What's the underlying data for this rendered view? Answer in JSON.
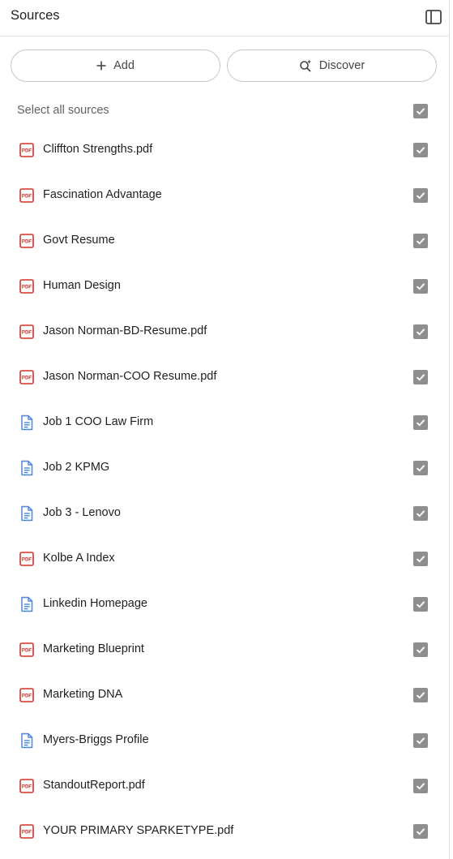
{
  "header": {
    "title": "Sources",
    "toggle_icon": "sidebar-panel-icon"
  },
  "actions": {
    "add_label": "Add",
    "add_icon": "plus-icon",
    "discover_label": "Discover",
    "discover_icon": "search-sparkle-icon"
  },
  "select_all": {
    "label": "Select all sources",
    "checked": true
  },
  "colors": {
    "pdf": "#d93025",
    "doc": "#4a86e8",
    "checkbox": "#8e8e8e"
  },
  "sources": [
    {
      "label": "Cliffton Strengths.pdf",
      "type": "pdf",
      "checked": true
    },
    {
      "label": "Fascination Advantage",
      "type": "pdf",
      "checked": true
    },
    {
      "label": "Govt Resume",
      "type": "pdf",
      "checked": true
    },
    {
      "label": "Human Design",
      "type": "pdf",
      "checked": true
    },
    {
      "label": "Jason Norman-BD-Resume.pdf",
      "type": "pdf",
      "checked": true
    },
    {
      "label": "Jason Norman-COO Resume.pdf",
      "type": "pdf",
      "checked": true
    },
    {
      "label": "Job 1 COO Law Firm",
      "type": "doc",
      "checked": true
    },
    {
      "label": "Job 2 KPMG",
      "type": "doc",
      "checked": true
    },
    {
      "label": "Job 3 - Lenovo",
      "type": "doc",
      "checked": true
    },
    {
      "label": "Kolbe A Index",
      "type": "pdf",
      "checked": true
    },
    {
      "label": "Linkedin Homepage",
      "type": "doc",
      "checked": true
    },
    {
      "label": "Marketing Blueprint",
      "type": "pdf",
      "checked": true
    },
    {
      "label": "Marketing DNA",
      "type": "pdf",
      "checked": true
    },
    {
      "label": "Myers-Briggs Profile",
      "type": "doc",
      "checked": true
    },
    {
      "label": "StandoutReport.pdf",
      "type": "pdf",
      "checked": true
    },
    {
      "label": "YOUR PRIMARY SPARKETYPE.pdf",
      "type": "pdf",
      "checked": true
    }
  ]
}
